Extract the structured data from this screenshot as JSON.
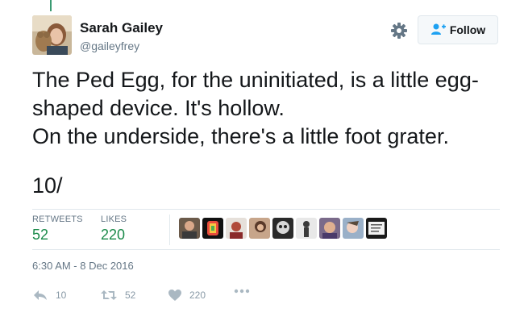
{
  "author": {
    "name": "Sarah Gailey",
    "handle": "@gaileyfrey"
  },
  "header": {
    "follow_label": "Follow"
  },
  "tweet": {
    "lines": [
      "The Ped Egg, for the uninitiated, is a little egg-shaped device. It's hollow.",
      "On the underside, there's a little foot grater."
    ],
    "numbering": "10/"
  },
  "stats": {
    "retweets_label": "RETWEETS",
    "retweets_value": "52",
    "likes_label": "LIKES",
    "likes_value": "220"
  },
  "timestamp": "6:30 AM - 8 Dec 2016",
  "actions": {
    "reply_count": "10",
    "retweet_count": "52",
    "like_count": "220"
  },
  "colors": {
    "stat_value": "#1b8a4a",
    "muted": "#657786",
    "thread_line": "#3a9a72"
  },
  "icons": [
    "gear-icon",
    "follow-person-icon",
    "reply-icon",
    "retweet-icon",
    "heart-icon",
    "more-icon"
  ]
}
